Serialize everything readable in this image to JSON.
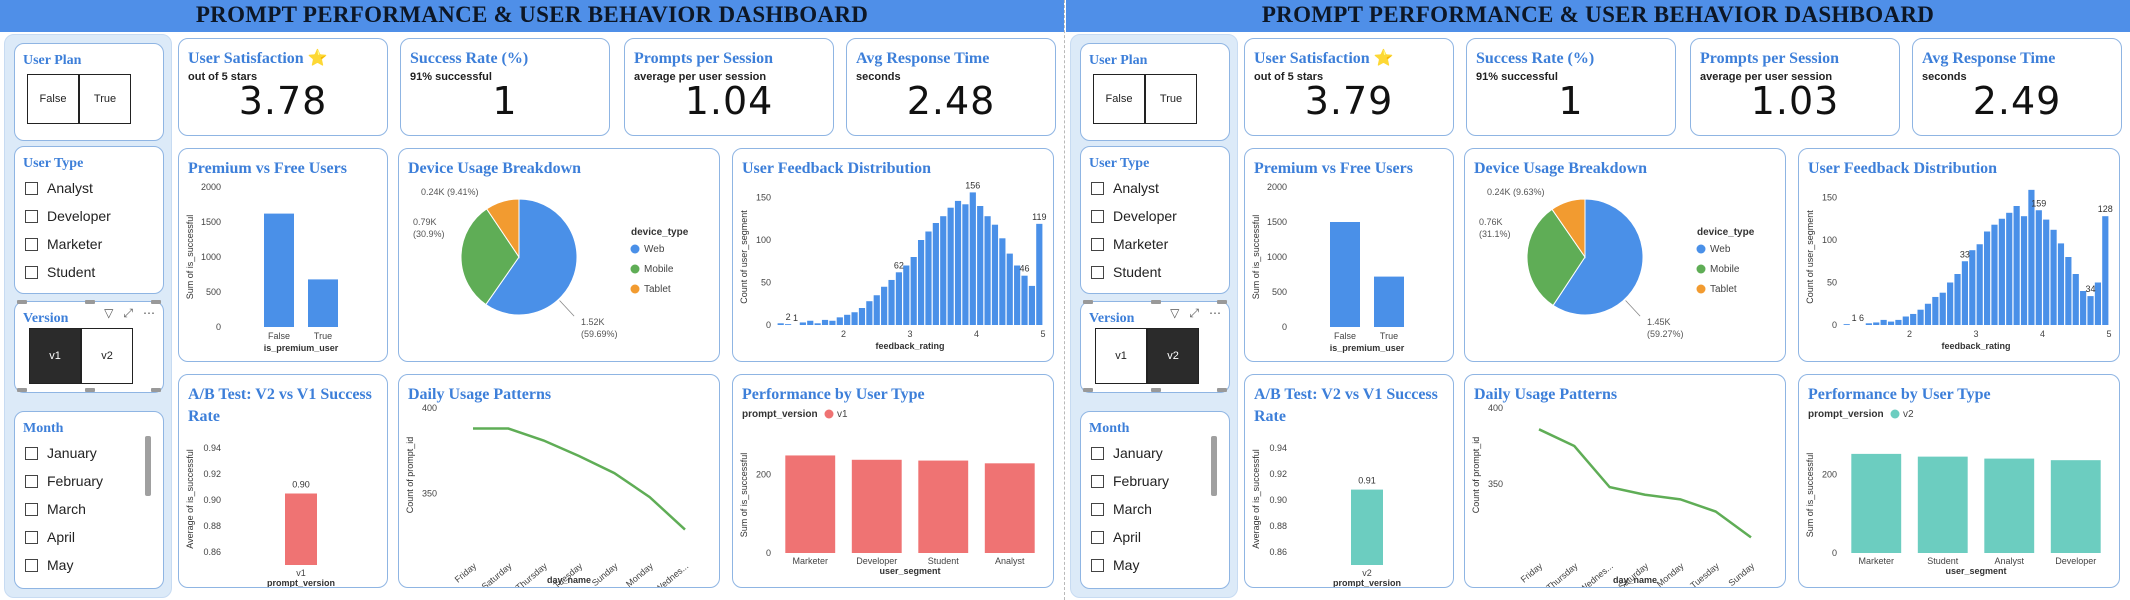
{
  "panels": [
    {
      "title": "PROMPT PERFORMANCE & USER BEHAVIOR DASHBOARD",
      "colors": {
        "accent": "#3d7fd9",
        "title_bar": "#4f8fe8",
        "ab_bar": "#ef7373",
        "series": "#ef7373"
      },
      "user_plan": {
        "title": "User Plan",
        "options": [
          "False",
          "True"
        ]
      },
      "user_type": {
        "title": "User Type",
        "options": [
          "Analyst",
          "Developer",
          "Marketer",
          "Student"
        ]
      },
      "version": {
        "title": "Version",
        "options": [
          "v1",
          "v2"
        ],
        "selected": "v1"
      },
      "month": {
        "title": "Month",
        "options": [
          "January",
          "February",
          "March",
          "April",
          "May"
        ]
      },
      "kpis": [
        {
          "title": "User Satisfaction",
          "icon": "star-icon",
          "subtitle": "out of 5 stars",
          "value": "3.78"
        },
        {
          "title": "Success Rate (%)",
          "subtitle": "91% successful",
          "value": "1"
        },
        {
          "title": "Prompts per Session",
          "subtitle": "average per user session",
          "value": "1.04"
        },
        {
          "title": "Avg Response Time",
          "subtitle": "seconds",
          "value": "2.48"
        }
      ],
      "charts": {
        "premium": {
          "type": "bar",
          "title": "Premium vs Free Users",
          "xlabel": "is_premium_user",
          "ylabel": "Sum of is_successful",
          "categories": [
            "False",
            "True"
          ],
          "values": [
            1620,
            680
          ],
          "ylim": [
            0,
            2000
          ],
          "yticks": [
            "0",
            "500",
            "1000",
            "1500",
            "2000"
          ]
        },
        "device": {
          "type": "pie",
          "title": "Device Usage Breakdown",
          "legend_title": "device_type",
          "slices": [
            {
              "name": "Web",
              "value": 59.69,
              "color": "#4a90e8"
            },
            {
              "name": "Mobile",
              "value": 30.9,
              "color": "#5fad56"
            },
            {
              "name": "Tablet",
              "value": 9.41,
              "color": "#f29b30"
            }
          ],
          "labels": [
            "1.52K",
            "(59.69%)",
            "0.79K",
            "(30.9%)",
            "0.24K (9.41%)"
          ]
        },
        "feedback": {
          "type": "bar",
          "title": "User Feedback Distribution",
          "xlabel": "feedback_rating",
          "ylabel": "Count of user_segment",
          "x_range": [
            1,
            5
          ],
          "ylim": [
            0,
            160
          ],
          "yticks": [
            "0",
            "50",
            "100",
            "150"
          ],
          "xticks": [
            "2",
            "3",
            "4",
            "5"
          ],
          "values": [
            2,
            1,
            0,
            3,
            5,
            2,
            6,
            5,
            9,
            12,
            15,
            20,
            28,
            35,
            45,
            53,
            62,
            70,
            80,
            100,
            110,
            120,
            128,
            138,
            146,
            142,
            156,
            140,
            128,
            118,
            102,
            84,
            70,
            58,
            46,
            119
          ],
          "data_labels": [
            "2",
            "1",
            "62",
            "156",
            "119",
            "46"
          ]
        },
        "ab": {
          "type": "bar",
          "title": "A/B Test: V2 vs V1 Success Rate",
          "xlabel": "prompt_version",
          "ylabel": "Average of is_successful",
          "categories": [
            "v1"
          ],
          "values": [
            0.905
          ],
          "data_label": "0.90",
          "ylim": [
            0.85,
            0.95
          ],
          "yticks": [
            "0.86",
            "0.88",
            "0.90",
            "0.92",
            "0.94"
          ]
        },
        "daily": {
          "type": "line",
          "title": "Daily Usage Patterns",
          "xlabel": "day_name",
          "ylabel": "Count of prompt_id",
          "categories": [
            "Friday",
            "Saturday",
            "Thursday",
            "Tuesday",
            "Sunday",
            "Monday",
            "Wednes..."
          ],
          "values": [
            388,
            388,
            381,
            372,
            362,
            348,
            329
          ],
          "ylim": [
            320,
            400
          ],
          "yticks": [
            "350",
            "400"
          ]
        },
        "perf": {
          "type": "bar",
          "title": "Performance by User Type",
          "legend_title": "prompt_version",
          "legend_item": "v1",
          "xlabel": "user_segment",
          "ylabel": "Sum of is_successful",
          "categories": [
            "Marketer",
            "Developer",
            "Student",
            "Analyst"
          ],
          "values": [
            248,
            237,
            235,
            228
          ],
          "ylim": [
            0,
            300
          ],
          "yticks": [
            "0",
            "200"
          ]
        }
      }
    },
    {
      "title": "PROMPT PERFORMANCE & USER BEHAVIOR DASHBOARD",
      "colors": {
        "accent": "#3d7fd9",
        "title_bar": "#4f8fe8",
        "ab_bar": "#6ccdc0",
        "series": "#6ccdc0"
      },
      "user_plan": {
        "title": "User Plan",
        "options": [
          "False",
          "True"
        ]
      },
      "user_type": {
        "title": "User Type",
        "options": [
          "Analyst",
          "Developer",
          "Marketer",
          "Student"
        ]
      },
      "version": {
        "title": "Version",
        "options": [
          "v1",
          "v2"
        ],
        "selected": "v2"
      },
      "month": {
        "title": "Month",
        "options": [
          "January",
          "February",
          "March",
          "April",
          "May"
        ]
      },
      "kpis": [
        {
          "title": "User Satisfaction",
          "icon": "star-icon",
          "subtitle": "out of 5 stars",
          "value": "3.79"
        },
        {
          "title": "Success Rate (%)",
          "subtitle": "91% successful",
          "value": "1"
        },
        {
          "title": "Prompts per Session",
          "subtitle": "average per user session",
          "value": "1.03"
        },
        {
          "title": "Avg Response Time",
          "subtitle": "seconds",
          "value": "2.49"
        }
      ],
      "charts": {
        "premium": {
          "type": "bar",
          "title": "Premium vs Free Users",
          "xlabel": "is_premium_user",
          "ylabel": "Sum of is_successful",
          "categories": [
            "False",
            "True"
          ],
          "values": [
            1500,
            720
          ],
          "ylim": [
            0,
            2000
          ],
          "yticks": [
            "0",
            "500",
            "1000",
            "1500",
            "2000"
          ]
        },
        "device": {
          "type": "pie",
          "title": "Device Usage Breakdown",
          "legend_title": "device_type",
          "slices": [
            {
              "name": "Web",
              "value": 59.27,
              "color": "#4a90e8"
            },
            {
              "name": "Mobile",
              "value": 31.1,
              "color": "#5fad56"
            },
            {
              "name": "Tablet",
              "value": 9.63,
              "color": "#f29b30"
            }
          ],
          "labels": [
            "1.45K",
            "(59.27%)",
            "0.76K",
            "(31.1%)",
            "0.24K (9.63%)"
          ]
        },
        "feedback": {
          "type": "bar",
          "title": "User Feedback Distribution",
          "xlabel": "feedback_rating",
          "ylabel": "Count of user_segment",
          "x_range": [
            1,
            5
          ],
          "ylim": [
            0,
            160
          ],
          "yticks": [
            "0",
            "50",
            "100",
            "150"
          ],
          "xticks": [
            "2",
            "3",
            "4",
            "5"
          ],
          "values": [
            1,
            0,
            0,
            2,
            3,
            6,
            4,
            6,
            10,
            13,
            18,
            25,
            33,
            38,
            50,
            60,
            75,
            88,
            95,
            110,
            118,
            125,
            132,
            140,
            128,
            159,
            135,
            124,
            112,
            96,
            80,
            60,
            40,
            34,
            50,
            128
          ],
          "data_labels": [
            "1",
            "6",
            "33",
            "159",
            "128",
            "34"
          ]
        },
        "ab": {
          "type": "bar",
          "title": "A/B Test: V2 vs V1 Success Rate",
          "xlabel": "prompt_version",
          "ylabel": "Average of is_successful",
          "categories": [
            "v2"
          ],
          "values": [
            0.908
          ],
          "data_label": "0.91",
          "ylim": [
            0.85,
            0.95
          ],
          "yticks": [
            "0.86",
            "0.88",
            "0.90",
            "0.92",
            "0.94"
          ]
        },
        "daily": {
          "type": "line",
          "title": "Daily Usage Patterns",
          "xlabel": "day_name",
          "ylabel": "Count of prompt_id",
          "categories": [
            "Friday",
            "Thursday",
            "Wednes...",
            "Saturday",
            "Monday",
            "Tuesday",
            "Sunday"
          ],
          "values": [
            386,
            375,
            348,
            343,
            340,
            332,
            315
          ],
          "ylim": [
            310,
            400
          ],
          "yticks": [
            "350",
            "400"
          ]
        },
        "perf": {
          "type": "bar",
          "title": "Performance by User Type",
          "legend_title": "prompt_version",
          "legend_item": "v2",
          "xlabel": "user_segment",
          "ylabel": "Sum of is_successful",
          "categories": [
            "Marketer",
            "Student",
            "Analyst",
            "Developer"
          ],
          "values": [
            252,
            245,
            240,
            236
          ],
          "ylim": [
            0,
            300
          ],
          "yticks": [
            "0",
            "200"
          ]
        }
      }
    }
  ]
}
